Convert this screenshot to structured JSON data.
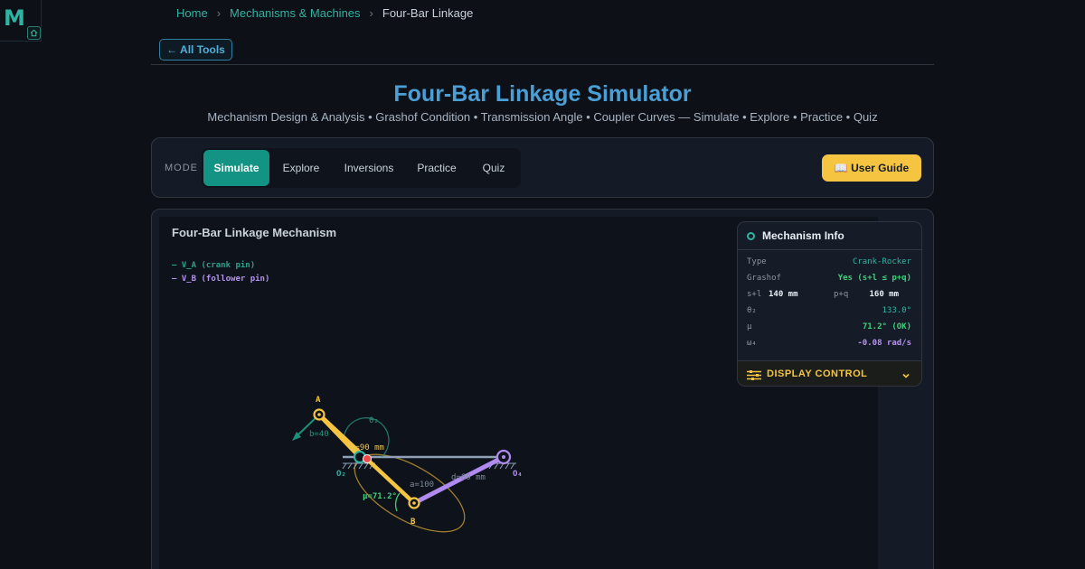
{
  "logo": {
    "letter": "M"
  },
  "breadcrumb": {
    "home": "Home",
    "section": "Mechanisms & Machines",
    "current": "Four-Bar Linkage"
  },
  "back_button": "← All Tools",
  "title": "Four-Bar Linkage Simulator",
  "subtitle": "Mechanism Design & Analysis • Grashof Condition • Transmission Angle • Coupler Curves — Simulate • Explore • Practice • Quiz",
  "mode": {
    "label": "MODE",
    "tabs": [
      {
        "label": "Simulate",
        "active": true
      },
      {
        "label": "Explore",
        "active": false
      },
      {
        "label": "Inversions",
        "active": false
      },
      {
        "label": "Practice",
        "active": false
      },
      {
        "label": "Quiz",
        "active": false
      }
    ],
    "guide_button": "📖 User Guide"
  },
  "canvas": {
    "title": "Four-Bar Linkage Mechanism",
    "legend": {
      "va": "— V_A (crank pin)",
      "vb": "— V_B (follower pin)"
    },
    "labels": {
      "a": "A",
      "b": "B",
      "o2": "O₂",
      "o4": "O₄",
      "theta": "θ₂",
      "link_b": "b=40",
      "link_a": "a=100",
      "link_c": "c=90 mm",
      "link_d": "d=80 mm",
      "mu": "μ=71.2°"
    },
    "colors": {
      "crank": "#f5c542",
      "follower": "#b08af0",
      "ground": "#8fa0b8",
      "velocity": "#1f8f7a",
      "coupler_curve": "#b8912e"
    }
  },
  "info": {
    "title": "Mechanism Info",
    "rows": {
      "type_k": "Type",
      "type_v": "Crank-Rocker",
      "grashof_k": "Grashof",
      "grashof_v": "Yes (s+l ≤ p+q)",
      "sl_k": "s+l",
      "sl_v": "140 mm",
      "pq_k": "p+q",
      "pq_v": "160 mm",
      "theta_k": "θ₂",
      "theta_v": "133.0°",
      "mu_k": "μ",
      "mu_v": "71.2° (OK)",
      "omega_k": "ω₄",
      "omega_v": "-0.08 rad/s"
    },
    "display_control": "DISPLAY CONTROL"
  }
}
